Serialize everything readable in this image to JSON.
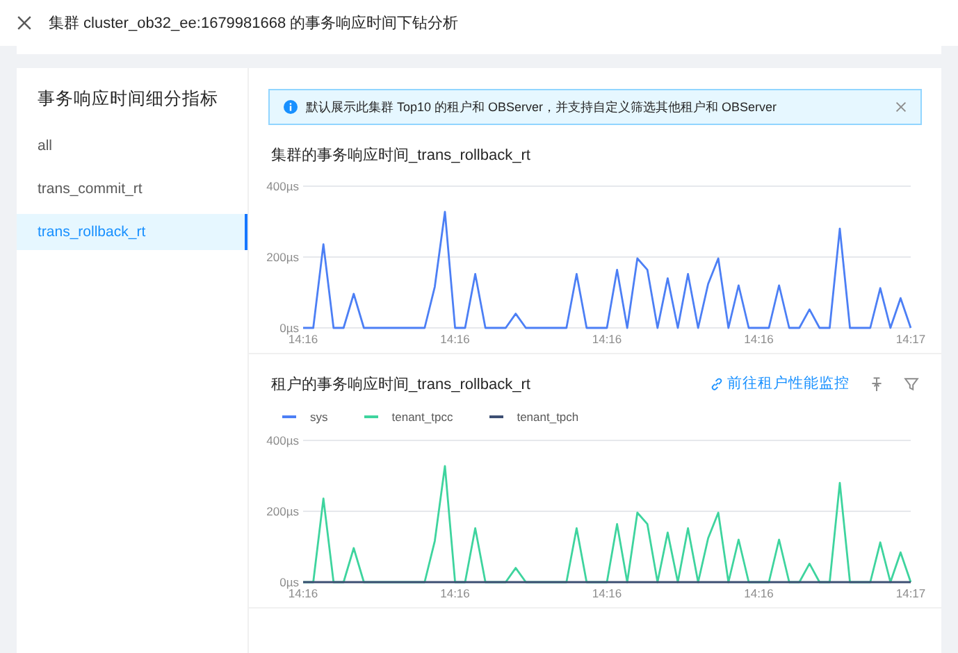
{
  "header": {
    "title": "集群 cluster_ob32_ee:1679981668 的事务响应时间下钻分析"
  },
  "sidebar": {
    "title": "事务响应时间细分指标",
    "items": [
      {
        "label": "all",
        "selected": false
      },
      {
        "label": "trans_commit_rt",
        "selected": false
      },
      {
        "label": "trans_rollback_rt",
        "selected": true
      }
    ]
  },
  "alert": {
    "text": "默认展示此集群 Top10 的租户和 OBServer，并支持自定义筛选其他租户和 OBServer"
  },
  "sections": [
    {
      "title": "集群的事务响应时间_trans_rollback_rt",
      "chart_data": {
        "type": "line",
        "ylim": [
          0,
          400
        ],
        "yticks": [
          {
            "value": 0,
            "label": "0µs"
          },
          {
            "value": 200,
            "label": "200µs"
          },
          {
            "value": 400,
            "label": "400µs"
          }
        ],
        "categories": [
          "14:16",
          null,
          null,
          null,
          null,
          null,
          null,
          null,
          null,
          null,
          null,
          null,
          null,
          null,
          null,
          "14:16",
          null,
          null,
          null,
          null,
          null,
          null,
          null,
          null,
          null,
          null,
          null,
          null,
          null,
          null,
          "14:16",
          null,
          null,
          null,
          null,
          null,
          null,
          null,
          null,
          null,
          null,
          null,
          null,
          null,
          null,
          "14:16",
          null,
          null,
          null,
          null,
          null,
          null,
          null,
          null,
          null,
          null,
          null,
          null,
          null,
          null,
          "14:17"
        ],
        "series": [
          {
            "color": "#4c7ff5",
            "values": [
              0,
              0,
              236,
              0,
              0,
              96,
              0,
              0,
              0,
              0,
              0,
              0,
              0,
              116,
              328,
              0,
              0,
              152,
              0,
              0,
              0,
              40,
              0,
              0,
              0,
              0,
              0,
              152,
              0,
              0,
              0,
              164,
              0,
              196,
              164,
              0,
              140,
              0,
              152,
              0,
              124,
              196,
              0,
              120,
              0,
              0,
              0,
              120,
              0,
              0,
              52,
              0,
              0,
              280,
              0,
              0,
              0,
              112,
              0,
              84,
              0
            ]
          }
        ]
      }
    },
    {
      "title": "租户的事务响应时间_trans_rollback_rt",
      "link": "前往租户性能监控",
      "chart_data": {
        "type": "line",
        "ylim": [
          0,
          400
        ],
        "yticks": [
          {
            "value": 0,
            "label": "0µs"
          },
          {
            "value": 200,
            "label": "200µs"
          },
          {
            "value": 400,
            "label": "400µs"
          }
        ],
        "categories": [
          "14:16",
          null,
          null,
          null,
          null,
          null,
          null,
          null,
          null,
          null,
          null,
          null,
          null,
          null,
          null,
          "14:16",
          null,
          null,
          null,
          null,
          null,
          null,
          null,
          null,
          null,
          null,
          null,
          null,
          null,
          null,
          "14:16",
          null,
          null,
          null,
          null,
          null,
          null,
          null,
          null,
          null,
          null,
          null,
          null,
          null,
          null,
          "14:16",
          null,
          null,
          null,
          null,
          null,
          null,
          null,
          null,
          null,
          null,
          null,
          null,
          null,
          null,
          "14:17"
        ],
        "series": [
          {
            "name": "sys",
            "color": "#4c7ff5",
            "values": [
              null,
              null,
              null,
              null,
              null,
              null,
              null,
              null,
              null,
              null,
              null,
              null,
              null,
              null,
              null,
              null,
              null,
              null,
              null,
              null,
              null,
              null,
              null,
              null,
              null,
              null,
              null,
              null,
              null,
              null,
              null,
              null,
              null,
              null,
              null,
              null,
              null,
              null,
              null,
              null,
              null,
              null,
              null,
              null,
              null,
              null,
              null,
              null,
              null,
              null,
              null,
              null,
              null,
              null,
              null,
              null,
              null,
              null,
              null,
              null,
              null
            ]
          },
          {
            "name": "tenant_tpcc",
            "color": "#3ed49e",
            "values": [
              0,
              0,
              236,
              0,
              0,
              96,
              0,
              0,
              0,
              0,
              0,
              0,
              0,
              116,
              328,
              0,
              0,
              152,
              0,
              0,
              0,
              40,
              0,
              0,
              0,
              0,
              0,
              152,
              0,
              0,
              0,
              164,
              0,
              196,
              164,
              0,
              140,
              0,
              152,
              0,
              124,
              196,
              0,
              120,
              0,
              0,
              0,
              120,
              0,
              0,
              52,
              0,
              0,
              280,
              0,
              0,
              0,
              112,
              0,
              84,
              0
            ]
          },
          {
            "name": "tenant_tpch",
            "color": "#3d4f73",
            "values": [
              0,
              0,
              0,
              0,
              0,
              0,
              0,
              0,
              0,
              0,
              0,
              0,
              0,
              0,
              0,
              0,
              0,
              0,
              0,
              0,
              0,
              0,
              0,
              0,
              0,
              0,
              0,
              0,
              0,
              0,
              0,
              0,
              0,
              0,
              0,
              0,
              0,
              0,
              0,
              0,
              0,
              0,
              0,
              0,
              0,
              0,
              0,
              0,
              0,
              0,
              0,
              0,
              0,
              0,
              0,
              0,
              0,
              0,
              0,
              0,
              0
            ]
          }
        ]
      }
    }
  ]
}
